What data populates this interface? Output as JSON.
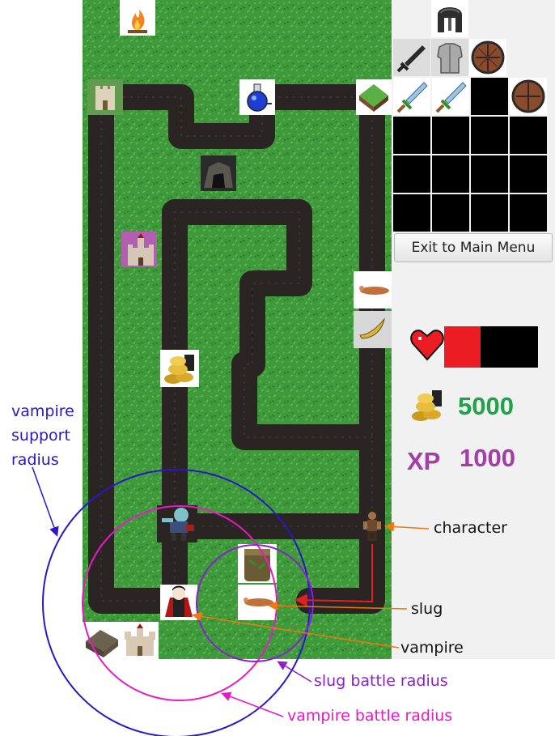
{
  "window": {
    "panel_bg": "#f1f1f1"
  },
  "world": {
    "grass_color": "#3f9a3c",
    "path_color": "#2a2522",
    "tiles": [
      "campfire",
      "castle",
      "potion",
      "grass-plot",
      "cave",
      "vampire-castle",
      "slug",
      "sword-item",
      "gold",
      "zombie",
      "tower",
      "slug",
      "vampire",
      "barracks",
      "village",
      "character"
    ]
  },
  "equipment": {
    "helmet": "helmet-icon",
    "weapon": "sword-icon",
    "armour": "armour-icon",
    "shield": "shield-icon"
  },
  "inventory": {
    "rows": [
      [
        "sword-icon",
        "sword-icon",
        "",
        "shield-icon"
      ],
      [
        "",
        "",
        "",
        ""
      ],
      [
        "",
        "",
        "",
        ""
      ],
      [
        "",
        "",
        "",
        ""
      ]
    ]
  },
  "menu": {
    "exit_label": "Exit to Main Menu"
  },
  "stats": {
    "health_fraction": 0.39,
    "health_color": "#ec1c24",
    "gold": "5000",
    "gold_color": "#1fa34a",
    "xp_label": "XP",
    "xp": "1000",
    "xp_color": "#a43da8"
  },
  "annotations": {
    "vampire_support_radius": [
      "vampire",
      "support",
      "radius"
    ],
    "character": "character",
    "slug": "slug",
    "vampire": "vampire",
    "slug_battle_radius": "slug battle radius",
    "vampire_battle_radius": "vampire battle radius",
    "colors": {
      "support": "#2b16c8",
      "vampire_battle": "#e819c6",
      "slug_battle": "#8c1fd0",
      "character": "#f07810",
      "slug": "#e02020",
      "vampire": "#f07810"
    }
  }
}
